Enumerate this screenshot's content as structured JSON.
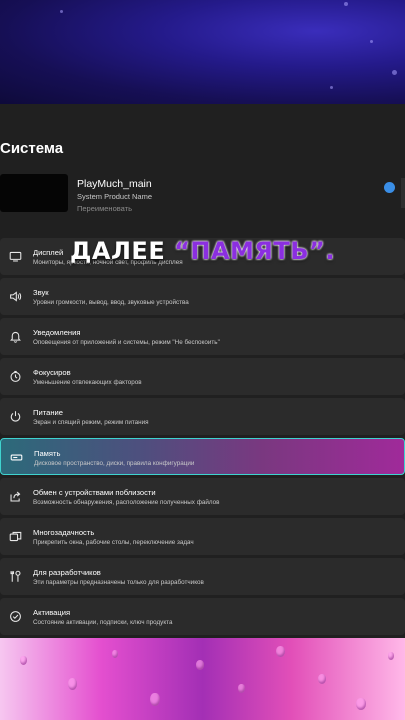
{
  "header": {
    "title": "Система"
  },
  "device": {
    "name": "PlayMuch_main",
    "model": "System Product Name",
    "rename": "Переименовать"
  },
  "settings": [
    {
      "title": "Дисплей",
      "subtitle": "Мониторы, яркость, ночной свет, профиль дисплея",
      "icon": "display-icon"
    },
    {
      "title": "Звук",
      "subtitle": "Уровни громкости, вывод, ввод, звуковые устройства",
      "icon": "speaker-icon"
    },
    {
      "title": "Уведомления",
      "subtitle": "Оповещения от приложений и системы, режим \"Не беспокоить\"",
      "icon": "bell-icon"
    },
    {
      "title": "Фокусиров",
      "subtitle": "Уменьшение отвлекающих факторов",
      "icon": "focus-icon"
    },
    {
      "title": "Питание",
      "subtitle": "Экран и спящий режим, режим питания",
      "icon": "power-icon"
    },
    {
      "title": "Память",
      "subtitle": "Дисковое пространство, диски, правила конфигурации",
      "icon": "storage-icon",
      "active": true
    },
    {
      "title": "Обмен с устройствами поблизости",
      "subtitle": "Возможность обнаружения, расположение полученных файлов",
      "icon": "share-icon"
    },
    {
      "title": "Многозадачность",
      "subtitle": "Прикрепить окна, рабочие столы, переключение задач",
      "icon": "multitask-icon"
    },
    {
      "title": "Для разработчиков",
      "subtitle": "Эти параметры предназначены только для разработчиков",
      "icon": "developer-tools-icon"
    },
    {
      "title": "Активация",
      "subtitle": "Состояние активации, подписки, ключ продукта",
      "icon": "activation-icon"
    }
  ],
  "caption": {
    "word1": "ДАЛЕЕ",
    "word2": "“ПАМЯТЬ”."
  },
  "colors": {
    "accent_border": "#3fd3cf",
    "caption_highlight": "#8b2fe0",
    "window_bg": "#202020",
    "item_bg": "#2b2b2b"
  }
}
